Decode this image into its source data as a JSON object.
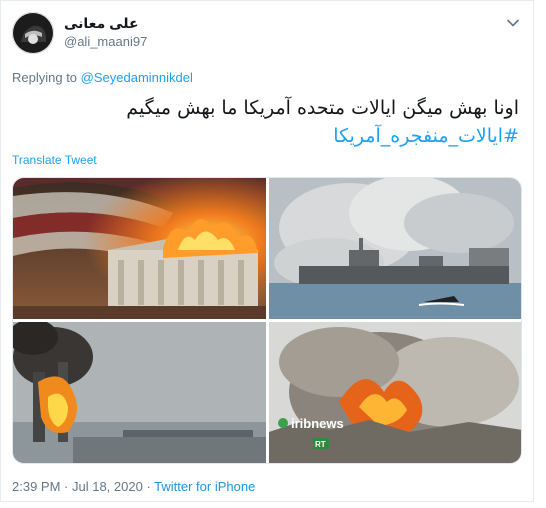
{
  "user": {
    "display_name": "علی معانی",
    "handle": "@ali_maani97"
  },
  "reply": {
    "prefix": "Replying to ",
    "to_handle": "@Seyedaminnikdel"
  },
  "tweet": {
    "line1": "اونا بهش میگن ایالات متحده آمریکا ما بهش میگیم",
    "hashtag": "#ایالات_منفجره_آمریکا"
  },
  "translate_label": "Translate Tweet",
  "media": {
    "photo4_watermark": "iribnews",
    "photo4_badge": "RT"
  },
  "footer": {
    "time": "2:39 PM",
    "separator": " · ",
    "date": "Jul 18, 2020",
    "source": "Twitter for iPhone"
  }
}
